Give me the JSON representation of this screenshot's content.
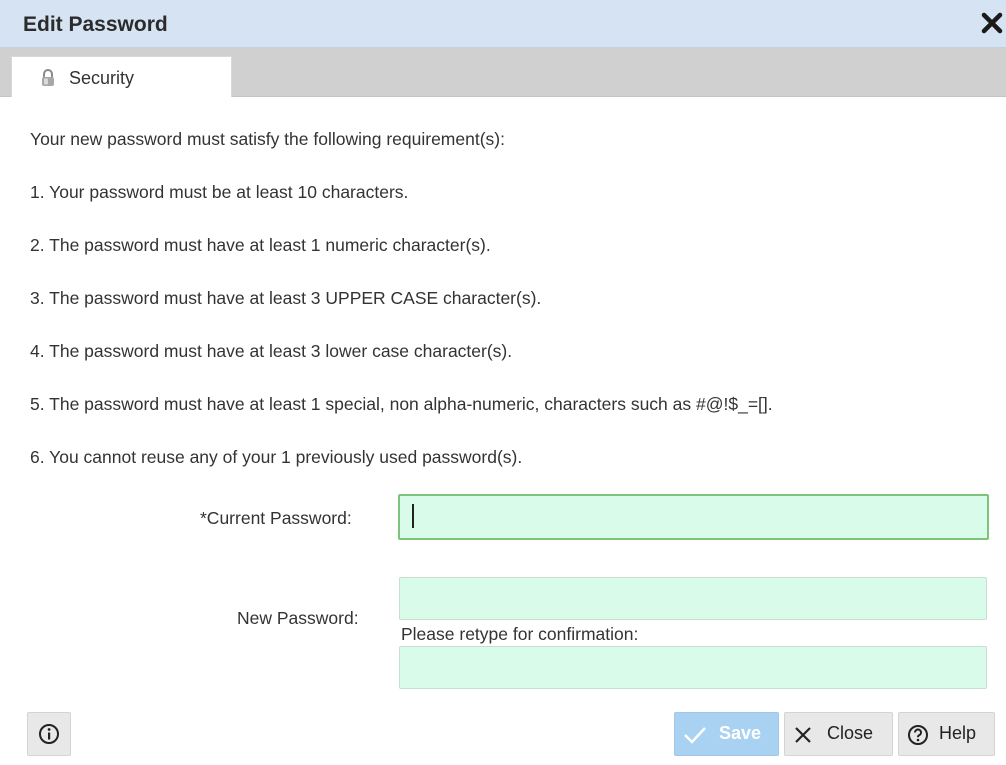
{
  "dialog": {
    "title": "Edit Password"
  },
  "tabs": [
    {
      "label": "Security",
      "icon": "lock-icon"
    }
  ],
  "requirements": {
    "intro": "Your new password must satisfy the following requirement(s):",
    "items": [
      "1. Your password must be at least 10 characters.",
      "2. The password must have at least 1 numeric character(s).",
      "3. The password must have at least 3 UPPER CASE character(s).",
      "4. The password must have at least 3 lower case character(s).",
      "5. The password must have at least 1 special, non alpha-numeric, characters such as #@!$_=[].",
      "6. You cannot reuse any of your 1 previously used password(s)."
    ]
  },
  "form": {
    "current_password_label": "*Current Password:",
    "current_password_value": "",
    "new_password_label": "New Password:",
    "new_password_value": "",
    "confirm_label": "Please retype for confirmation:",
    "confirm_value": ""
  },
  "footer": {
    "info_icon": "info-icon",
    "save_label": "Save",
    "close_label": "Close",
    "help_label": "Help"
  },
  "colors": {
    "titlebar": "#d6e3f3",
    "field_bg": "#d9fbe9",
    "focus_border": "#7fc27a",
    "save_button": "#a9d2f2"
  }
}
